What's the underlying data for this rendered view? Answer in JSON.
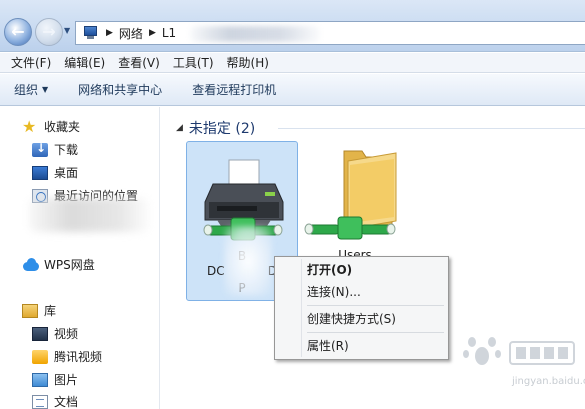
{
  "address_bar": {
    "crumbs": [
      "网络",
      "L1"
    ]
  },
  "menu_bar": {
    "items": [
      "文件(F)",
      "编辑(E)",
      "查看(V)",
      "工具(T)",
      "帮助(H)"
    ]
  },
  "command_bar": {
    "items": [
      "组织",
      "网络和共享中心",
      "查看远程打印机"
    ]
  },
  "nav_pane": {
    "favorites": "收藏夹",
    "downloads": "下载",
    "desktop": "桌面",
    "recent": "最近访问的位置",
    "wps": "WPS网盘",
    "library": "库",
    "videos": "视频",
    "tencent_video": "腾讯视频",
    "pictures": "图片",
    "documents": "文档"
  },
  "content": {
    "group_title": "未指定 (2)",
    "printer_label_lines": [
      "B",
      "DC",
      "D",
      "P"
    ],
    "users_label": "Users"
  },
  "context_menu": {
    "items": [
      "打开(O)",
      "连接(N)...",
      "创建快捷方式(S)",
      "属性(R)"
    ]
  },
  "watermark": {
    "text": "jingyan.baidu.com"
  },
  "colors": {
    "selection": "#cde3f8",
    "accent": "#1e3a6e",
    "folder": "#f1c75a",
    "share_pipe": "#2ea84a"
  }
}
